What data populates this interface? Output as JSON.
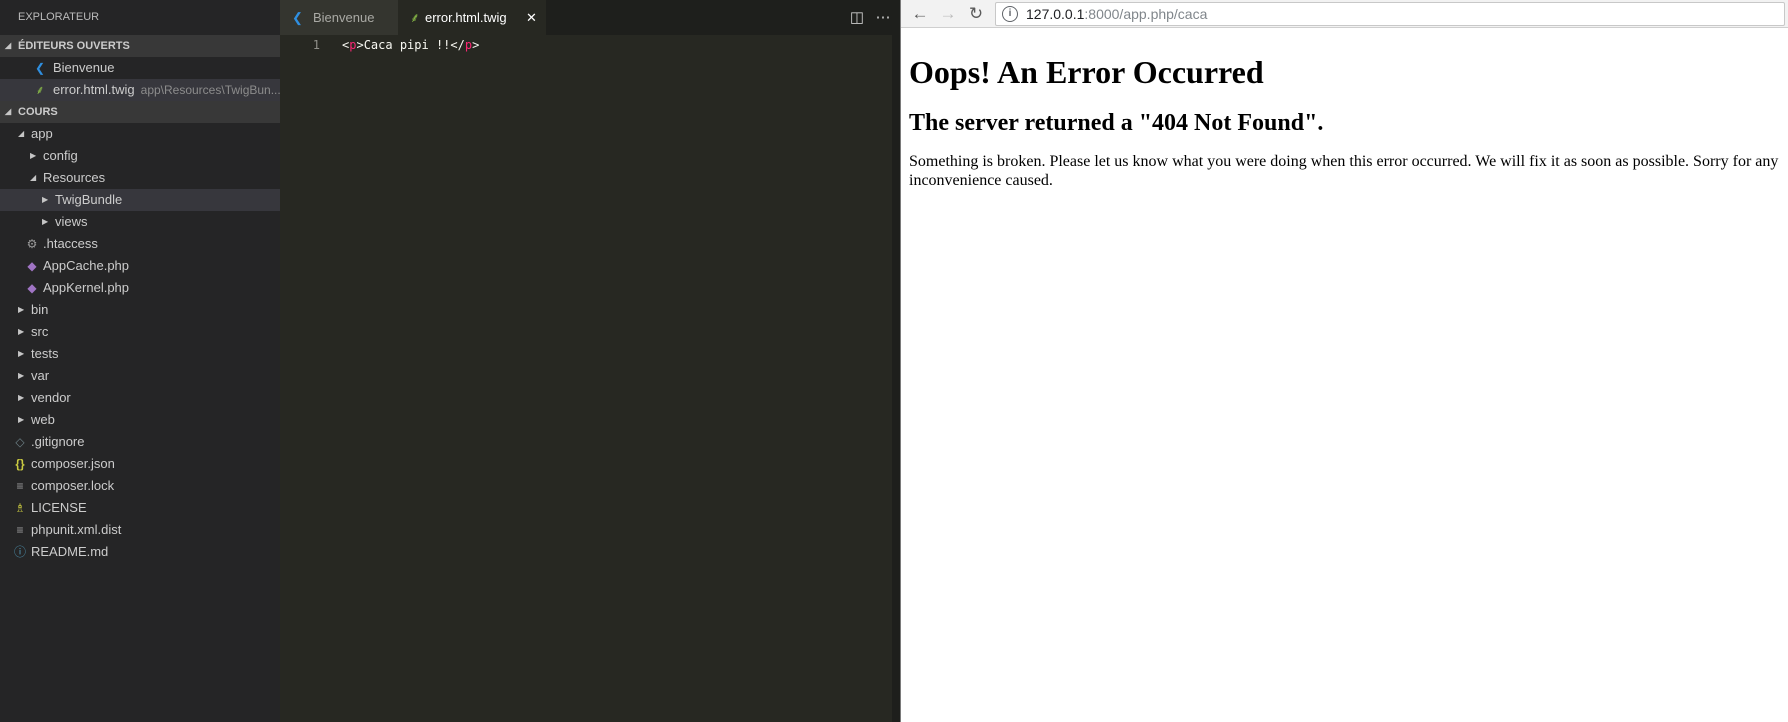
{
  "explorer": {
    "title": "EXPLORATEUR",
    "open_editors_header": "ÉDITEURS OUVERTS",
    "open_editors": [
      {
        "label": "Bienvenue",
        "desc": ""
      },
      {
        "label": "error.html.twig",
        "desc": "app\\Resources\\TwigBun..."
      }
    ],
    "project_header": "COURS",
    "tree": {
      "app": "app",
      "config": "config",
      "resources": "Resources",
      "twigbundle": "TwigBundle",
      "views": "views",
      "htaccess": ".htaccess",
      "appcache": "AppCache.php",
      "appkernel": "AppKernel.php",
      "bin": "bin",
      "src": "src",
      "tests": "tests",
      "var": "var",
      "vendor": "vendor",
      "web": "web",
      "gitignore": ".gitignore",
      "composer_json": "composer.json",
      "composer_lock": "composer.lock",
      "license": "LICENSE",
      "phpunit": "phpunit.xml.dist",
      "readme": "README.md"
    }
  },
  "editor": {
    "tabs": [
      {
        "label": "Bienvenue",
        "active": false
      },
      {
        "label": "error.html.twig",
        "active": true
      }
    ],
    "line_number": "1",
    "code": {
      "open_bracket": "<",
      "open_tag": "p",
      "close_bracket": ">",
      "text": "Caca pipi !!",
      "close_open_bracket": "</",
      "close_tag": "p",
      "close_close_bracket": ">"
    }
  },
  "browser": {
    "url_host": "127.0.0.1",
    "url_path": ":8000/app.php/caca",
    "heading": "Oops! An Error Occurred",
    "subheading": "The server returned a \"404 Not Found\".",
    "message": "Something is broken. Please let us know what you were doing when this error occurred. We will fix it as soon as possible. Sorry for any inconvenience caused."
  },
  "colors": {
    "vscode_blue": "#2f8fe0",
    "twig_green": "#8dc149",
    "php_purple": "#a074c4",
    "tag_pink": "#f92672"
  }
}
